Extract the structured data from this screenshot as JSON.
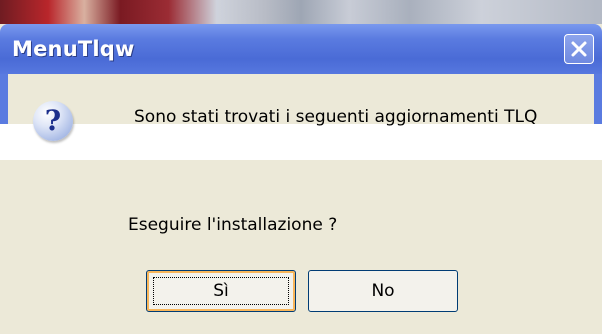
{
  "dialog": {
    "title": "MenuTlqw",
    "message_line1": "Sono stati trovati i seguenti aggiornamenti TLQ",
    "message_line2": "Eseguire l'installazione ?",
    "icon": "question-icon",
    "buttons": {
      "yes_label": "Sì",
      "no_label": "No"
    },
    "close_icon": "close-icon"
  },
  "colors": {
    "titlebar": "#5a7be0",
    "dialog_bg": "#ece9d8",
    "focus_outline": "#f8b65a",
    "button_border": "#003c74"
  }
}
